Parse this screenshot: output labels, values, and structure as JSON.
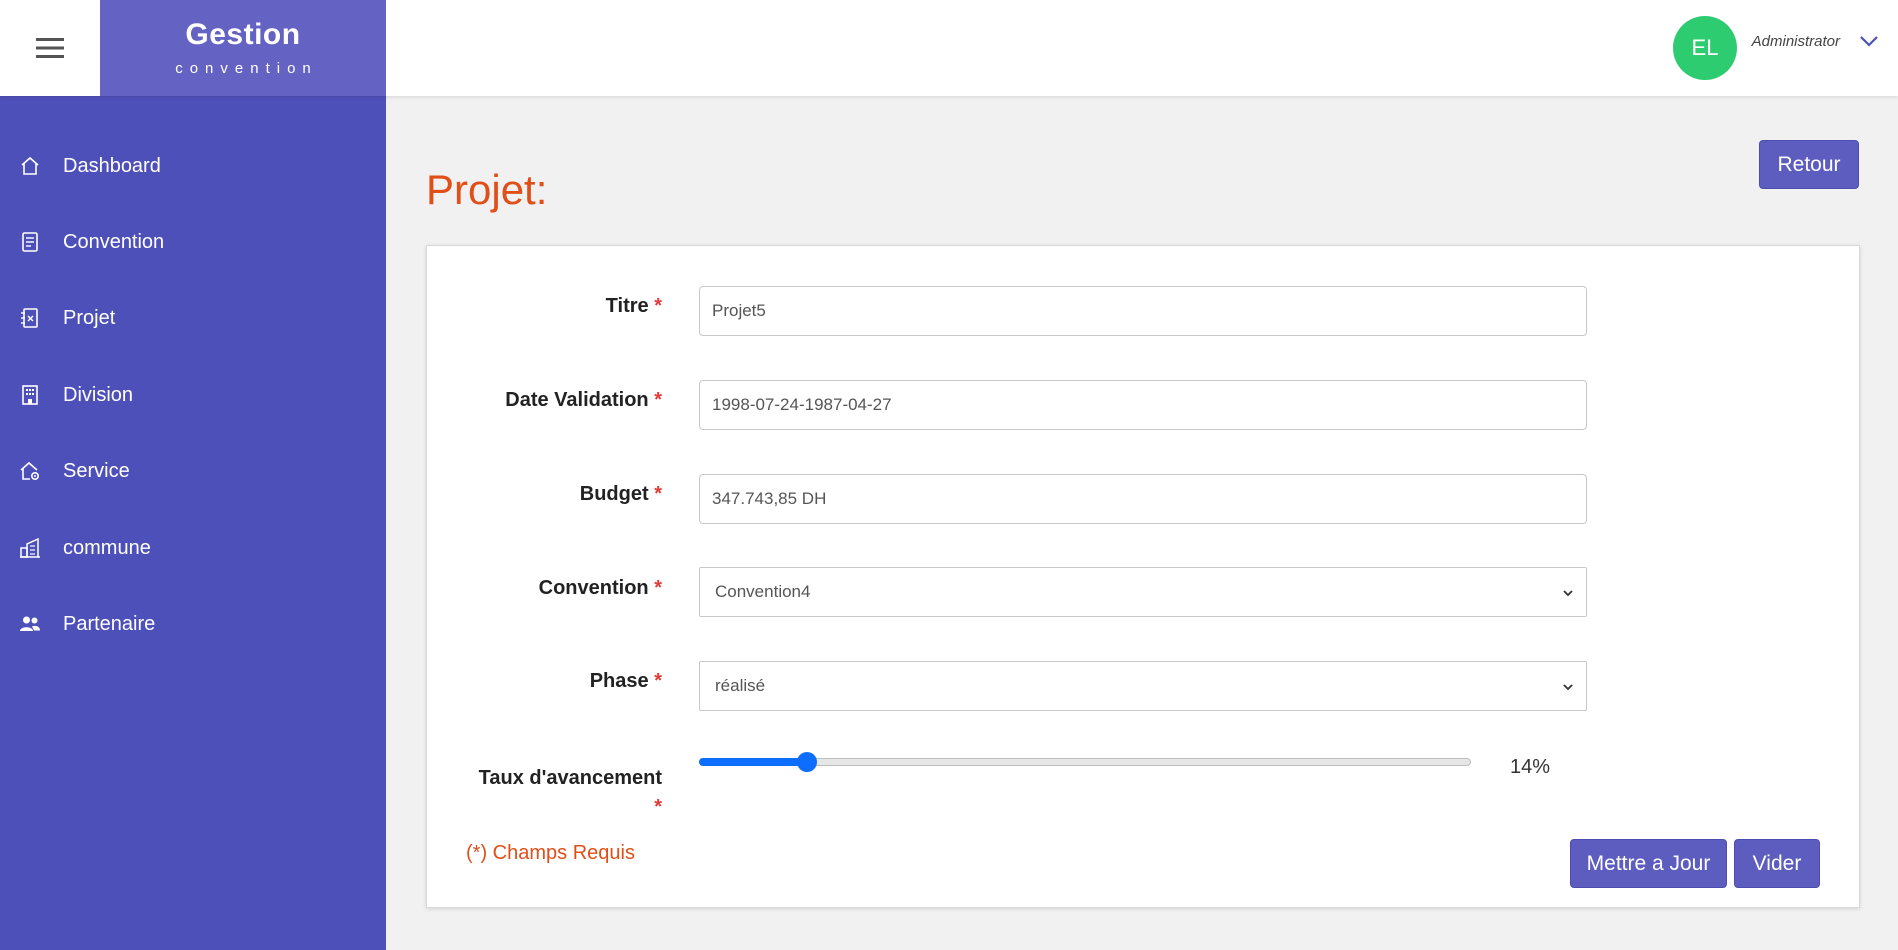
{
  "header": {
    "brand_title": "Gestion",
    "brand_subtitle": "convention",
    "avatar_initials": "EL",
    "avatar_color": "#2ecc71",
    "username": "Administrator"
  },
  "sidebar": {
    "background": "#4e50b9",
    "items": [
      {
        "label": "Dashboard",
        "icon": "home-icon"
      },
      {
        "label": "Convention",
        "icon": "document-icon"
      },
      {
        "label": "Projet",
        "icon": "project-icon"
      },
      {
        "label": "Division",
        "icon": "building-icon"
      },
      {
        "label": "Service",
        "icon": "house-gear-icon"
      },
      {
        "label": "commune",
        "icon": "city-icon"
      },
      {
        "label": "Partenaire",
        "icon": "users-icon"
      }
    ]
  },
  "page": {
    "title": "Projet:",
    "back_button": "Retour"
  },
  "form": {
    "required_mark": "*",
    "titre": {
      "label": "Titre",
      "value": "Projet5"
    },
    "date_validation": {
      "label": "Date Validation",
      "value": "1998-07-24-1987-04-27"
    },
    "budget": {
      "label": "Budget",
      "value": "347.743,85 DH"
    },
    "convention": {
      "label": "Convention",
      "selected": "Convention4"
    },
    "phase": {
      "label": "Phase",
      "selected": "réalisé"
    },
    "taux": {
      "label": "Taux d'avancement",
      "value": 14,
      "display": "14%"
    },
    "required_note": "(*) Champs Requis",
    "update_button": "Mettre a Jour",
    "clear_button": "Vider"
  },
  "colors": {
    "accent": "#5d5dc0",
    "title": "#e04f18",
    "slider": "#0d6efd"
  }
}
